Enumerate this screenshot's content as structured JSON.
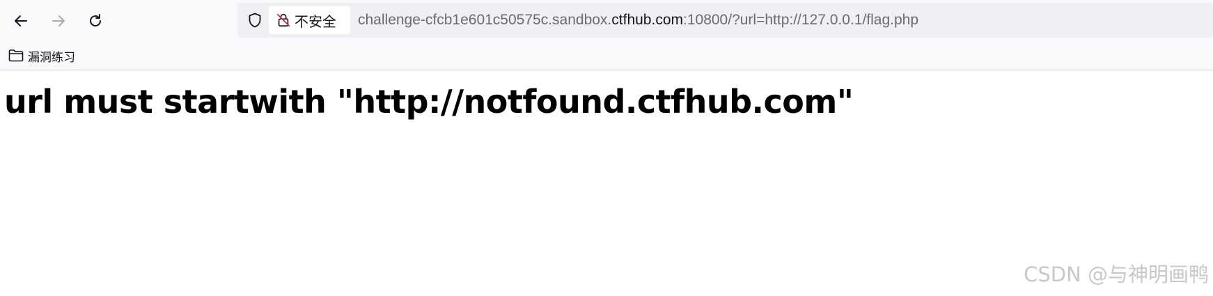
{
  "browser": {
    "nav": {
      "back_icon": "arrow-left-icon",
      "forward_icon": "arrow-right-icon",
      "reload_icon": "reload-icon"
    },
    "urlbar": {
      "shield_icon": "shield-icon",
      "security_icon": "lock-insecure-icon",
      "security_label": "不安全",
      "url_prefix": "challenge-cfcb1e601c50575c.sandbox.",
      "url_domain": "ctfhub.com",
      "url_suffix": ":10800/?url=http://127.0.0.1/flag.php"
    },
    "bookmarks": [
      {
        "icon": "folder-icon",
        "label": "漏洞练习"
      }
    ]
  },
  "page": {
    "heading": "url must startwith \"http://notfound.ctfhub.com\""
  },
  "watermark": "CSDN @与神明画鸭",
  "colors": {
    "toolbar_bg": "#f9f9fb",
    "urlbar_bg": "#f0f0f4",
    "insecure_accent": "#e22850",
    "text": "#15141a",
    "url_muted": "#6b6a70"
  }
}
